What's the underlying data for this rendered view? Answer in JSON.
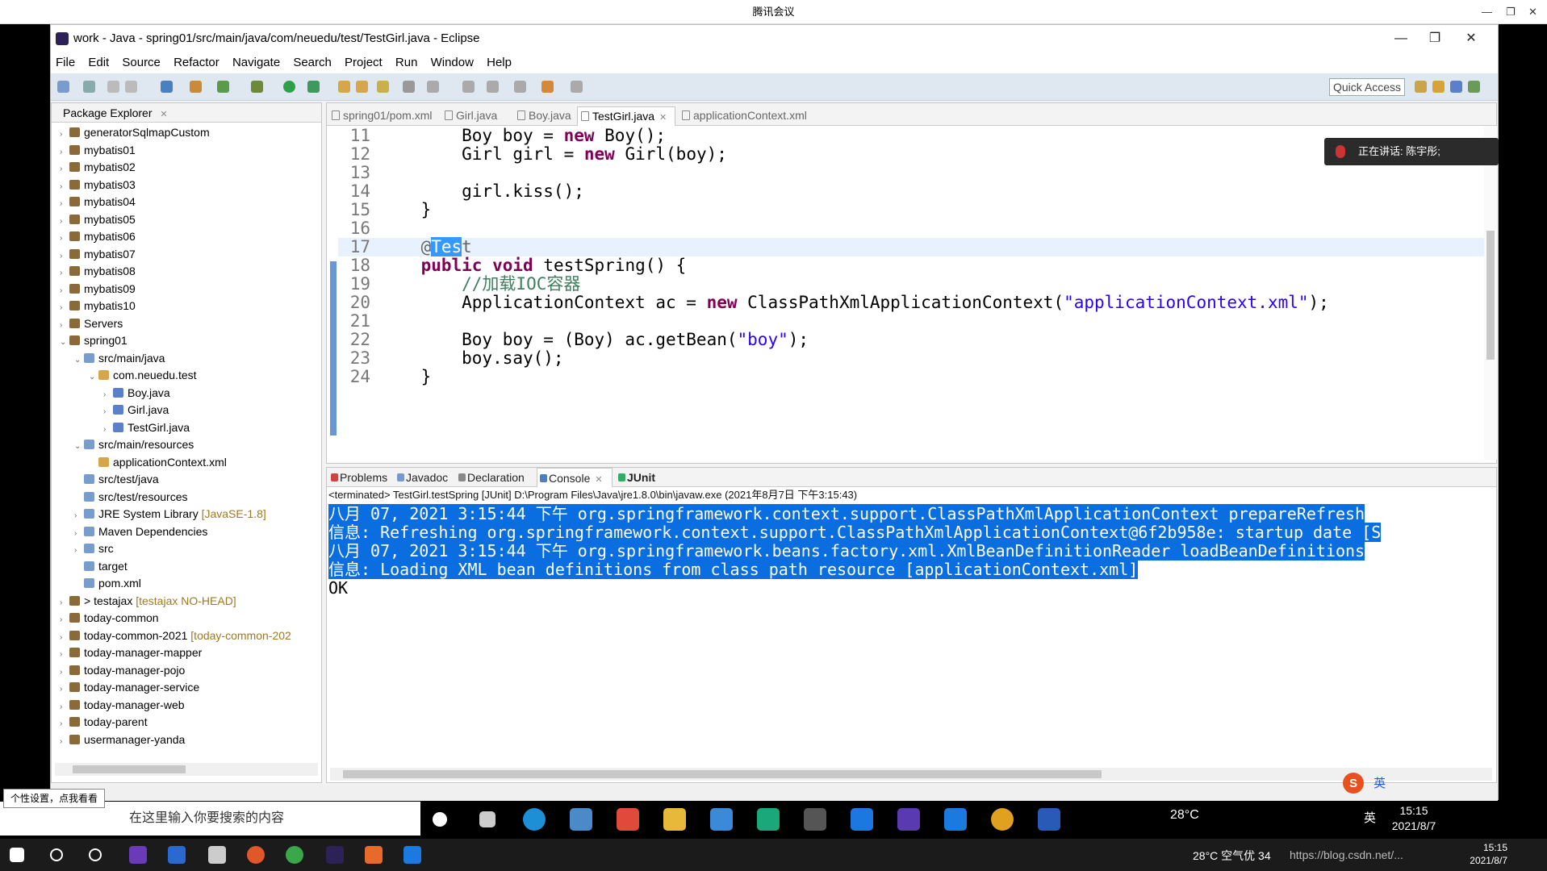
{
  "meeting": {
    "title": "腾讯会议",
    "controls": [
      "—",
      "❐",
      "✕"
    ]
  },
  "window": {
    "title": "work - Java - spring01/src/main/java/com/neuedu/test/TestGirl.java - Eclipse",
    "controls": [
      "—",
      "❐",
      "✕"
    ]
  },
  "menu": [
    "File",
    "Edit",
    "Source",
    "Refactor",
    "Navigate",
    "Search",
    "Project",
    "Run",
    "Window",
    "Help"
  ],
  "toolbar": {
    "quick_access": "Quick Access"
  },
  "package_explorer": {
    "title": "Package Explorer",
    "items": [
      {
        "label": "generatorSqlmapCustom",
        "level": 0,
        "arrow": "›"
      },
      {
        "label": "mybatis01",
        "level": 0,
        "arrow": "›"
      },
      {
        "label": "mybatis02",
        "level": 0,
        "arrow": "›"
      },
      {
        "label": "mybatis03",
        "level": 0,
        "arrow": "›"
      },
      {
        "label": "mybatis04",
        "level": 0,
        "arrow": "›"
      },
      {
        "label": "mybatis05",
        "level": 0,
        "arrow": "›"
      },
      {
        "label": "mybatis06",
        "level": 0,
        "arrow": "›"
      },
      {
        "label": "mybatis07",
        "level": 0,
        "arrow": "›"
      },
      {
        "label": "mybatis08",
        "level": 0,
        "arrow": "›"
      },
      {
        "label": "mybatis09",
        "level": 0,
        "arrow": "›"
      },
      {
        "label": "mybatis10",
        "level": 0,
        "arrow": "›"
      },
      {
        "label": "Servers",
        "level": 0,
        "arrow": "›"
      },
      {
        "label": "spring01",
        "level": 0,
        "arrow": "⌄"
      },
      {
        "label": "src/main/java",
        "level": 1,
        "arrow": "⌄"
      },
      {
        "label": "com.neuedu.test",
        "level": 2,
        "arrow": "⌄"
      },
      {
        "label": "Boy.java",
        "level": 3,
        "arrow": "›"
      },
      {
        "label": "Girl.java",
        "level": 3,
        "arrow": "›"
      },
      {
        "label": "TestGirl.java",
        "level": 3,
        "arrow": "›"
      },
      {
        "label": "src/main/resources",
        "level": 1,
        "arrow": "⌄"
      },
      {
        "label": "applicationContext.xml",
        "level": 2,
        "arrow": ""
      },
      {
        "label": "src/test/java",
        "level": 1,
        "arrow": ""
      },
      {
        "label": "src/test/resources",
        "level": 1,
        "arrow": ""
      },
      {
        "label": "JRE System Library",
        "decoration": "[JavaSE-1.8]",
        "level": 1,
        "arrow": "›"
      },
      {
        "label": "Maven Dependencies",
        "level": 1,
        "arrow": "›"
      },
      {
        "label": "src",
        "level": 1,
        "arrow": "›"
      },
      {
        "label": "target",
        "level": 1,
        "arrow": ""
      },
      {
        "label": "pom.xml",
        "level": 1,
        "arrow": ""
      },
      {
        "label": "> testajax",
        "decoration": "[testajax NO-HEAD]",
        "level": 0,
        "arrow": "›"
      },
      {
        "label": "today-common",
        "level": 0,
        "arrow": "›"
      },
      {
        "label": "today-common-2021",
        "decoration": "[today-common-202",
        "level": 0,
        "arrow": "›"
      },
      {
        "label": "today-manager-mapper",
        "level": 0,
        "arrow": "›"
      },
      {
        "label": "today-manager-pojo",
        "level": 0,
        "arrow": "›"
      },
      {
        "label": "today-manager-service",
        "level": 0,
        "arrow": "›"
      },
      {
        "label": "today-manager-web",
        "level": 0,
        "arrow": "›"
      },
      {
        "label": "today-parent",
        "level": 0,
        "arrow": "›"
      },
      {
        "label": "usermanager-yanda",
        "level": 0,
        "arrow": "›"
      }
    ]
  },
  "editor": {
    "tabs": [
      "spring01/pom.xml",
      "Girl.java",
      "Boy.java",
      "TestGirl.java",
      "applicationContext.xml"
    ],
    "active_tab": 3,
    "lines": [
      {
        "n": "11",
        "code": "        Boy boy = new Boy();"
      },
      {
        "n": "12",
        "code": "        Girl girl = new Girl(boy);"
      },
      {
        "n": "13",
        "code": ""
      },
      {
        "n": "14",
        "code": "        girl.kiss();"
      },
      {
        "n": "15",
        "code": "    }"
      },
      {
        "n": "16",
        "code": ""
      },
      {
        "n": "17",
        "code": "    @Test"
      },
      {
        "n": "18",
        "code": "    public void testSpring() {"
      },
      {
        "n": "19",
        "code": "        //加载IOC容器"
      },
      {
        "n": "20",
        "code": "        ApplicationContext ac = new ClassPathXmlApplicationContext(\"applicationContext.xml\");"
      },
      {
        "n": "21",
        "code": ""
      },
      {
        "n": "22",
        "code": "        Boy boy = (Boy) ac.getBean(\"boy\");"
      },
      {
        "n": "23",
        "code": "        boy.say();"
      },
      {
        "n": "24",
        "code": "    }"
      }
    ]
  },
  "speaker_overlay": {
    "text": "正在讲话: 陈宇彤;"
  },
  "console": {
    "tabs": [
      "Problems",
      "Javadoc",
      "Declaration",
      "Console",
      "JUnit"
    ],
    "active_tab": 3,
    "status": "<terminated> TestGirl.testSpring [JUnit] D:\\Program Files\\Java\\jre1.8.0\\bin\\javaw.exe (2021年8月7日 下午3:15:43)",
    "lines": [
      {
        "text": "八月 07, 2021 3:15:44 下午 org.springframework.context.support.ClassPathXmlApplicationContext prepareRefresh",
        "red": true,
        "selected": true
      },
      {
        "text": "信息: Refreshing org.springframework.context.support.ClassPathXmlApplicationContext@6f2b958e: startup date [S",
        "red": true,
        "selected": true
      },
      {
        "text": "八月 07, 2021 3:15:44 下午 org.springframework.beans.factory.xml.XmlBeanDefinitionReader loadBeanDefinitions",
        "red": true,
        "selected": true
      },
      {
        "text": "信息: Loading XML bean definitions from class path resource [applicationContext.xml]",
        "red": true,
        "selected": true
      },
      {
        "text": "OK",
        "red": false,
        "selected": false
      }
    ]
  },
  "ime": {
    "lang": "英"
  },
  "inner_taskbar": {
    "tooltip": "个性设置，点我看看",
    "search_placeholder": "在这里输入你要搜索的内容",
    "temp": "28°C",
    "lang": "英",
    "time": "15:15",
    "date": "2021/8/7"
  },
  "outer_taskbar": {
    "weather": "28°C 空气优 34",
    "time": "15:15",
    "date": "2021/8/7",
    "watermark": "https://blog.csdn.net/..."
  },
  "colors": {
    "keyword": "#7f0055",
    "string": "#2a00ff",
    "comment": "#3f7f5f",
    "selection": "#3399ff",
    "console_selection": "#0a6ee0"
  }
}
